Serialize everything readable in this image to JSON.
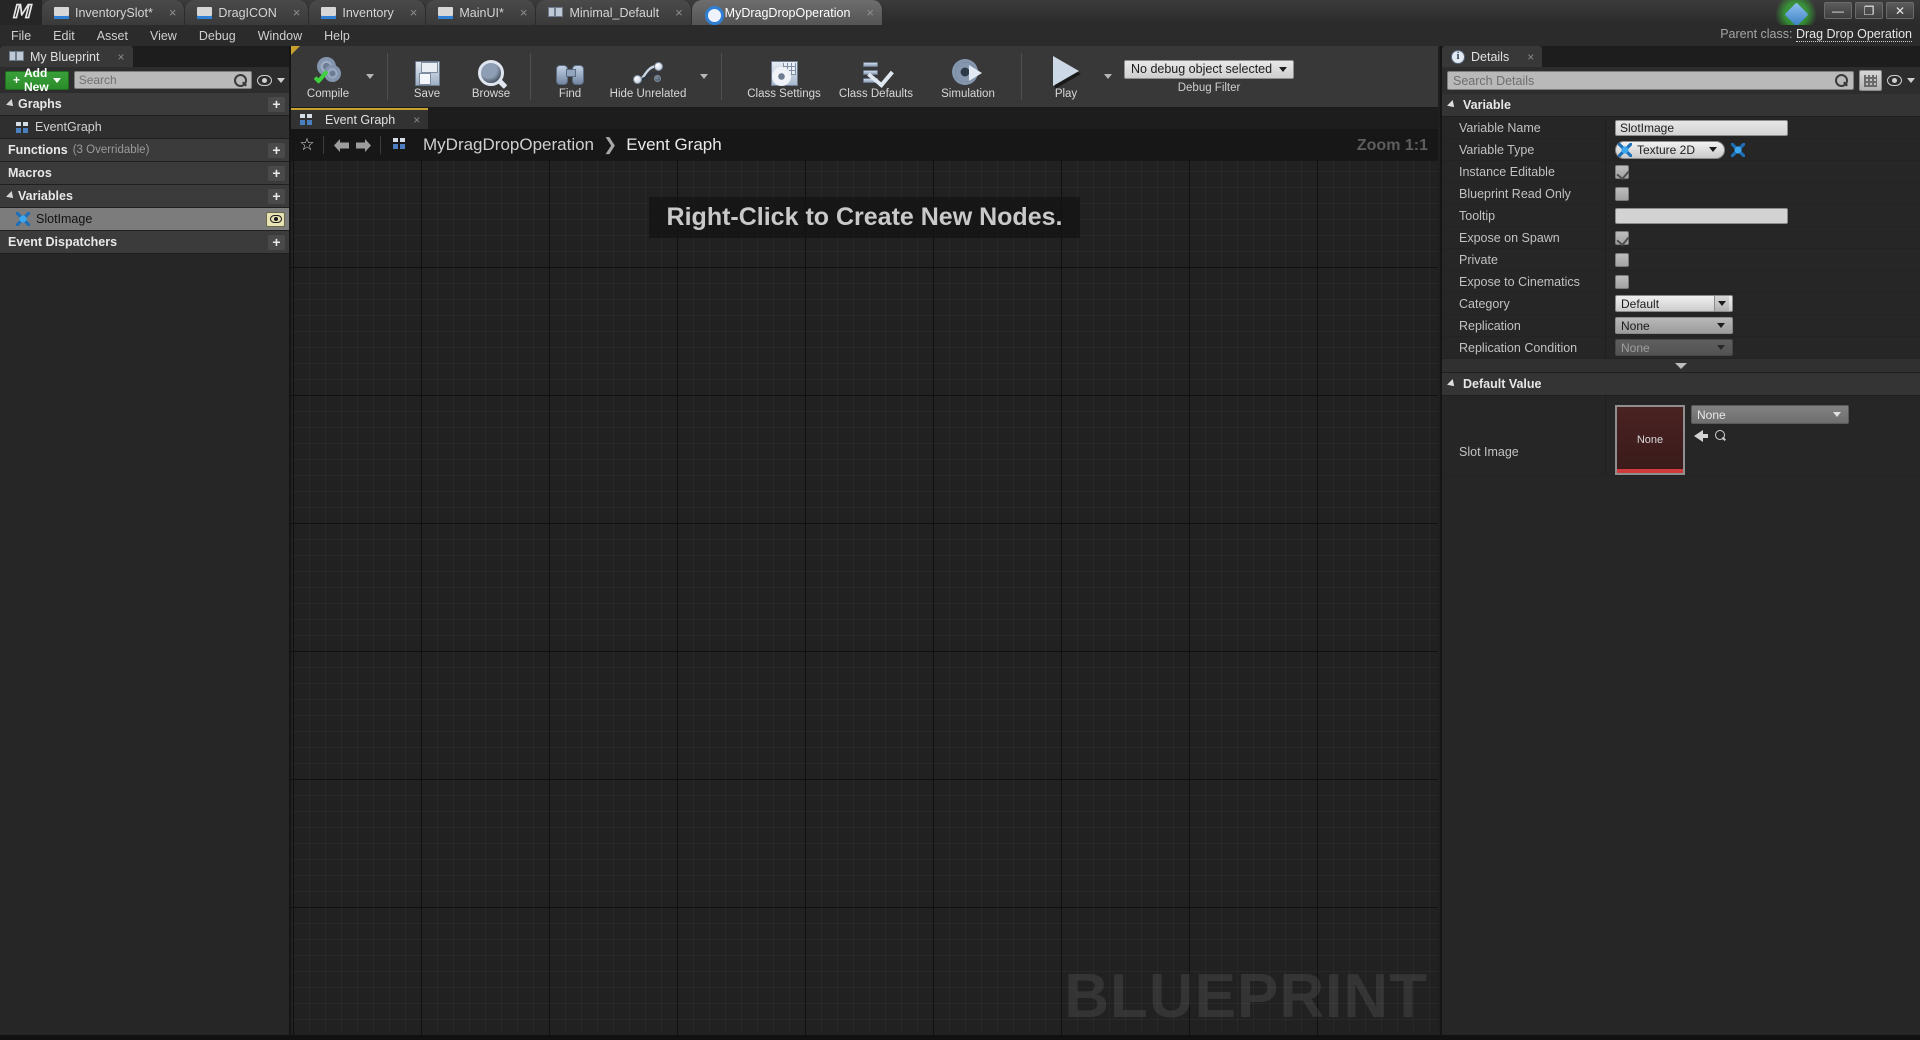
{
  "window": {
    "logo": "unreal-logo",
    "parent_class_label": "Parent class:",
    "parent_class_value": "Drag Drop Operation",
    "controls": {
      "minimize": "—",
      "restore": "❐",
      "close": "✕"
    }
  },
  "document_tabs": [
    {
      "label": "InventorySlot*",
      "icon": "widget-icon",
      "active": false,
      "close": "×"
    },
    {
      "label": "DragICON",
      "icon": "widget-icon",
      "active": false,
      "close": "×"
    },
    {
      "label": "Inventory",
      "icon": "widget-icon",
      "active": false,
      "close": "×"
    },
    {
      "label": "MainUI*",
      "icon": "widget-icon",
      "active": false,
      "close": "×"
    },
    {
      "label": "Minimal_Default",
      "icon": "level-icon",
      "active": false,
      "close": "×"
    },
    {
      "label": "MyDragDropOperation",
      "icon": "blueprint-circle-icon",
      "active": true,
      "close": "×"
    }
  ],
  "menu": [
    "File",
    "Edit",
    "Asset",
    "View",
    "Debug",
    "Window",
    "Help"
  ],
  "my_blueprint": {
    "tab_label": "My Blueprint",
    "tab_close": "×",
    "add_new_label": "Add New",
    "search_placeholder": "Search",
    "search_value": "",
    "sections": [
      {
        "name": "Graphs",
        "type": "section",
        "expandable": true,
        "add": "+"
      },
      {
        "name": "EventGraph",
        "type": "child",
        "icon": "graph-icon",
        "selected": false
      },
      {
        "name": "Functions",
        "type": "section",
        "expandable": false,
        "sub": "(3 Overridable)",
        "add": "+"
      },
      {
        "name": "Macros",
        "type": "section",
        "expandable": false,
        "add": "+"
      },
      {
        "name": "Variables",
        "type": "section",
        "expandable": true,
        "add": "+"
      },
      {
        "name": "SlotImage",
        "type": "child",
        "icon": "texture-icon",
        "selected": true,
        "eye": "visibility-eye-icon"
      },
      {
        "name": "Event Dispatchers",
        "type": "section",
        "expandable": false,
        "add": "+"
      }
    ]
  },
  "toolbar": {
    "buttons": [
      {
        "label": "Compile",
        "icon": "compile-gears-icon",
        "has_dropdown": true
      },
      {
        "label": "Save",
        "icon": "save-floppy-icon"
      },
      {
        "label": "Browse",
        "icon": "browse-magnifier-icon"
      },
      {
        "label": "Find",
        "icon": "find-binoculars-icon"
      },
      {
        "label": "Hide Unrelated",
        "icon": "hide-unrelated-nodes-icon",
        "has_dropdown": true
      },
      {
        "label": "Class Settings",
        "icon": "class-settings-icon"
      },
      {
        "label": "Class Defaults",
        "icon": "class-defaults-icon"
      },
      {
        "label": "Simulation",
        "icon": "simulation-icon"
      },
      {
        "label": "Play",
        "icon": "play-icon",
        "has_dropdown": true
      }
    ],
    "debug_object": "No debug object selected",
    "debug_filter_label": "Debug Filter"
  },
  "graph": {
    "tab_label": "Event Graph",
    "tab_close": "×",
    "breadcrumb": [
      "MyDragDropOperation",
      "Event Graph"
    ],
    "breadcrumb_separator": "❯",
    "hint_text": "Right-Click to Create New Nodes.",
    "zoom_label": "Zoom 1:1",
    "watermark": "BLUEPRINT",
    "icons": {
      "bookmark": "star-icon",
      "back": "back-arrow-icon",
      "forward": "forward-arrow-icon"
    }
  },
  "details": {
    "tab_label": "Details",
    "tab_close": "×",
    "search_placeholder": "Search Details",
    "search_value": "",
    "sections": [
      {
        "title": "Variable",
        "rows": [
          {
            "label": "Variable Name",
            "kind": "text",
            "value": "SlotImage"
          },
          {
            "label": "Variable Type",
            "kind": "type",
            "value": "Texture 2D"
          },
          {
            "label": "Instance Editable",
            "kind": "check",
            "checked": true
          },
          {
            "label": "Blueprint Read Only",
            "kind": "check",
            "checked": false
          },
          {
            "label": "Tooltip",
            "kind": "text",
            "value": ""
          },
          {
            "label": "Expose on Spawn",
            "kind": "check",
            "checked": true
          },
          {
            "label": "Private",
            "kind": "check",
            "checked": false
          },
          {
            "label": "Expose to Cinematics",
            "kind": "check",
            "checked": false
          },
          {
            "label": "Category",
            "kind": "combo",
            "value": "Default"
          },
          {
            "label": "Replication",
            "kind": "combo-dark",
            "value": "None"
          },
          {
            "label": "Replication Condition",
            "kind": "combo-disabled",
            "value": "None"
          }
        ]
      },
      {
        "title": "Default Value",
        "rows": [
          {
            "label": "Slot Image",
            "kind": "asset",
            "thumbnail_text": "None",
            "value": "None"
          }
        ]
      }
    ]
  },
  "colors": {
    "accent_yellow": "#c8a22e",
    "add_new_green": "#2a8c2a",
    "selection_grey": "#7c7c7c",
    "thumbnail_red": "#cf3b3b",
    "panel_bg": "#262626",
    "canvas_bg": "#212121"
  }
}
